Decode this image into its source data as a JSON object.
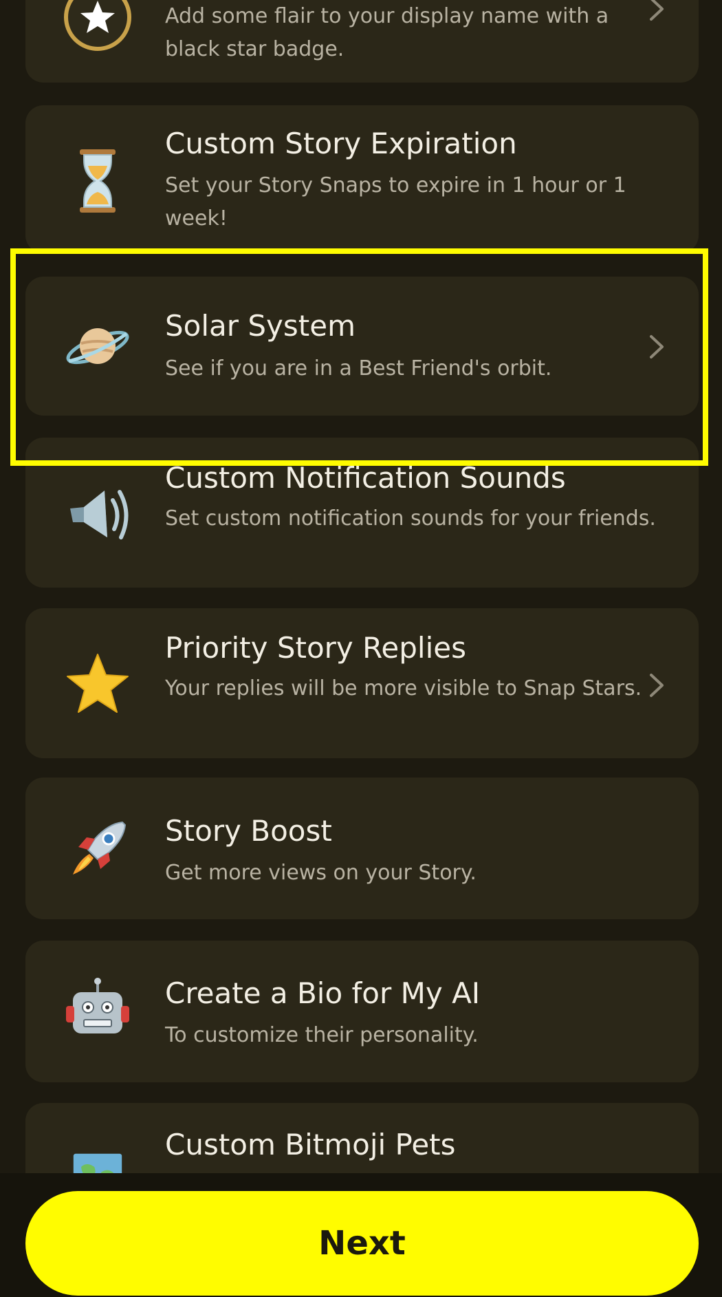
{
  "items": [
    {
      "title": "",
      "desc": "Add some flair to your display name with a black star badge.",
      "icon": "black-star-badge-icon"
    },
    {
      "title": "Custom Story Expiration",
      "desc": "Set your Story Snaps to expire in 1 hour or 1 week!",
      "icon": "hourglass-icon"
    },
    {
      "title": "Solar System",
      "desc": "See if you are in a Best Friend's orbit.",
      "icon": "planet-icon"
    },
    {
      "title": "Custom Notification Sounds",
      "desc": "Set custom notification sounds for your friends.",
      "icon": "speaker-icon"
    },
    {
      "title": "Priority Story Replies",
      "desc": "Your replies will be more visible to Snap Stars.",
      "icon": "star-icon"
    },
    {
      "title": "Story Boost",
      "desc": "Get more views on your Story.",
      "icon": "rocket-icon"
    },
    {
      "title": "Create a Bio for My AI",
      "desc": "To customize their personality.",
      "icon": "robot-icon"
    },
    {
      "title": "Custom Bitmoji Pets",
      "desc": "",
      "icon": "map-icon"
    }
  ],
  "next_button": {
    "label": "Next"
  },
  "colors": {
    "accent": "#fffc00",
    "background": "#1d1a10",
    "card": "#2b2718"
  }
}
